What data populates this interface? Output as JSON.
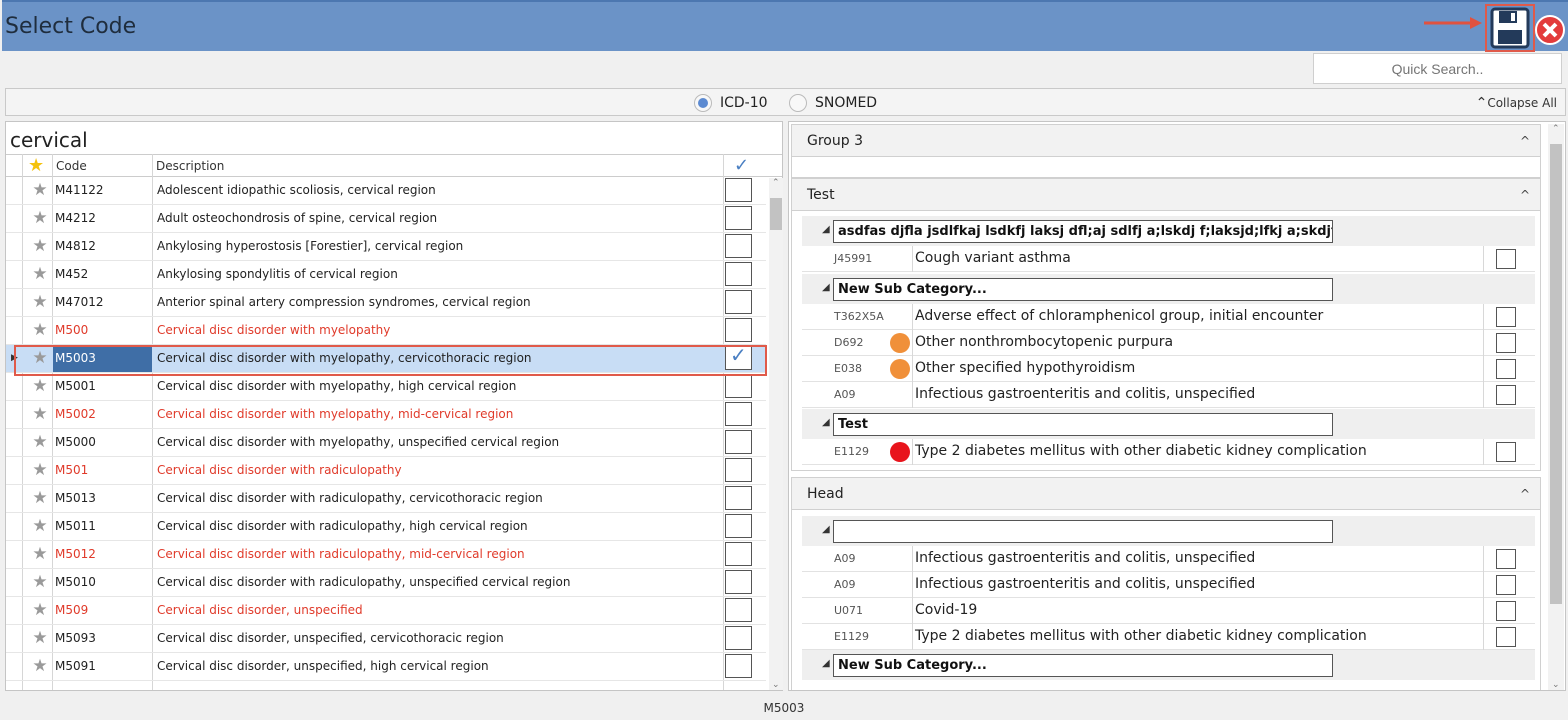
{
  "window": {
    "title": "Select Code"
  },
  "toolbar": {
    "quick_search_placeholder": "Quick Search..",
    "radios": [
      {
        "label": "ICD-10",
        "selected": true
      },
      {
        "label": "SNOMED",
        "selected": false
      }
    ],
    "collapse_all": "Collapse All"
  },
  "left": {
    "search_term": "cervical",
    "columns": {
      "code": "Code",
      "description": "Description"
    },
    "rows": [
      {
        "code": "M41122",
        "desc": "Adolescent idiopathic scoliosis, cervical region",
        "red": false,
        "checked": false
      },
      {
        "code": "M4212",
        "desc": "Adult osteochondrosis of spine, cervical region",
        "red": false,
        "checked": false
      },
      {
        "code": "M4812",
        "desc": "Ankylosing hyperostosis [Forestier], cervical region",
        "red": false,
        "checked": false
      },
      {
        "code": "M452",
        "desc": "Ankylosing spondylitis of cervical region",
        "red": false,
        "checked": false
      },
      {
        "code": "M47012",
        "desc": "Anterior spinal artery compression syndromes, cervical region",
        "red": false,
        "checked": false
      },
      {
        "code": "M500",
        "desc": "Cervical disc disorder with myelopathy",
        "red": true,
        "checked": false
      },
      {
        "code": "M5003",
        "desc": "Cervical disc disorder with myelopathy, cervicothoracic region",
        "red": false,
        "checked": true,
        "selected": true
      },
      {
        "code": "M5001",
        "desc": "Cervical disc disorder with myelopathy, high cervical region",
        "red": false,
        "checked": false
      },
      {
        "code": "M5002",
        "desc": "Cervical disc disorder with myelopathy, mid-cervical region",
        "red": true,
        "checked": false
      },
      {
        "code": "M5000",
        "desc": "Cervical disc disorder with myelopathy, unspecified cervical region",
        "red": false,
        "checked": false
      },
      {
        "code": "M501",
        "desc": "Cervical disc disorder with radiculopathy",
        "red": true,
        "checked": false
      },
      {
        "code": "M5013",
        "desc": "Cervical disc disorder with radiculopathy, cervicothoracic region",
        "red": false,
        "checked": false
      },
      {
        "code": "M5011",
        "desc": "Cervical disc disorder with radiculopathy, high cervical region",
        "red": false,
        "checked": false
      },
      {
        "code": "M5012",
        "desc": "Cervical disc disorder with radiculopathy, mid-cervical region",
        "red": true,
        "checked": false
      },
      {
        "code": "M5010",
        "desc": "Cervical disc disorder with radiculopathy, unspecified cervical region",
        "red": false,
        "checked": false
      },
      {
        "code": "M509",
        "desc": "Cervical disc disorder, unspecified",
        "red": true,
        "checked": false
      },
      {
        "code": "M5093",
        "desc": "Cervical disc disorder, unspecified, cervicothoracic region",
        "red": false,
        "checked": false
      },
      {
        "code": "M5091",
        "desc": "Cervical disc disorder, unspecified, high cervical region",
        "red": false,
        "checked": false
      }
    ]
  },
  "right": {
    "group3": {
      "title": "Group 3"
    },
    "test": {
      "title": "Test",
      "sub1": "asdfas djfla jsdlfkaj lsdkfj laksj dfl;aj sdlfj a;lskdj f;laksjd;lfkj a;skdjf;lkajs;ldfasdf",
      "item1": {
        "code": "J45991",
        "desc": "Cough variant asthma"
      },
      "sub2": "New Sub Category...",
      "items2": [
        {
          "code": "T362X5A",
          "desc": "Adverse effect of chloramphenicol group, initial encounter",
          "dot": ""
        },
        {
          "code": "D692",
          "desc": "Other nonthrombocytopenic purpura",
          "dot": "#f0903a"
        },
        {
          "code": "E038",
          "desc": "Other specified hypothyroidism",
          "dot": "#f0903a"
        },
        {
          "code": "A09",
          "desc": "Infectious gastroenteritis and colitis, unspecified",
          "dot": ""
        }
      ],
      "sub3": "Test",
      "item3": {
        "code": "E1129",
        "desc": "Type 2 diabetes mellitus with other diabetic kidney complication",
        "dot": "#e8141c"
      }
    },
    "head": {
      "title": "Head",
      "sub1": "",
      "items": [
        {
          "code": "A09",
          "desc": "Infectious gastroenteritis and colitis, unspecified"
        },
        {
          "code": "A09",
          "desc": "Infectious gastroenteritis and colitis, unspecified"
        },
        {
          "code": "U071",
          "desc": "Covid-19"
        },
        {
          "code": "E1129",
          "desc": "Type 2 diabetes mellitus with other diabetic kidney complication"
        }
      ],
      "sub2": "New Sub Category..."
    }
  },
  "status": {
    "selected_code": "M5003"
  }
}
